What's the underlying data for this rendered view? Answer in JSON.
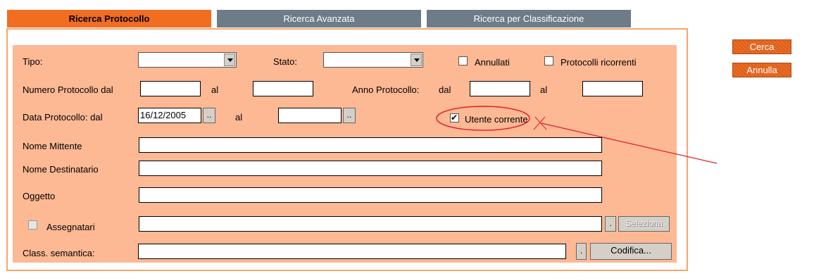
{
  "tabs": [
    {
      "label": "Ricerca Protocollo"
    },
    {
      "label": "Ricerca Avanzata"
    },
    {
      "label": "Ricerca per Classificazione"
    }
  ],
  "form": {
    "tipo_label": "Tipo:",
    "tipo_value": "",
    "stato_label": "Stato:",
    "stato_value": "",
    "annullati_label": "Annullati",
    "protocolli_ricorrenti_label": "Protocolli ricorrenti",
    "numero_protocollo_label": "Numero Protocollo dal",
    "numero_al_label": "al",
    "anno_protocollo_label": "Anno Protocollo:",
    "anno_dal_label": "dal",
    "anno_al_label": "al",
    "data_protocollo_label": "Data Protocollo: dal",
    "data_dal_value": "16/12/2005",
    "data_al_label": "al",
    "picker_label": "..",
    "utente_corrente_label": "Utente corrente",
    "nome_mittente_label": "Nome Mittente",
    "nome_destinatario_label": "Nome Destinatario",
    "oggetto_label": "Oggetto",
    "assegnatari_label": "Assegnatari",
    "assegnatari_dot": ".",
    "seleziona_label": "Seleziona",
    "class_semantica_label": "Class. semantica:",
    "class_dot": ".",
    "codifica_label": "Codifica..."
  },
  "actions": {
    "cerca_label": "Cerca",
    "annulla_label": "Annulla"
  },
  "colors": {
    "accent": "#f26c21",
    "panel": "#fdb894",
    "tab_inactive": "#6e7c87",
    "annotation": "#e02020"
  }
}
